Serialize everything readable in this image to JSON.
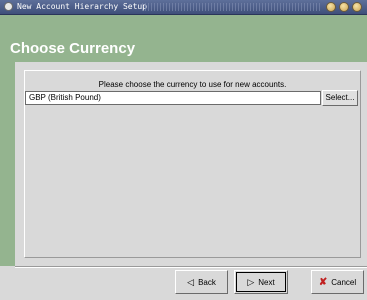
{
  "window": {
    "title": "New Account Hierarchy Setup",
    "controls": [
      "minimize",
      "maximize",
      "close"
    ]
  },
  "page": {
    "heading": "Choose Currency",
    "prompt": "Please choose the currency to use for new accounts.",
    "currency_value": "GBP (British Pound)",
    "select_label": "Select..."
  },
  "buttons": {
    "back": {
      "label": "Back",
      "icon": "arrow-left-icon"
    },
    "next": {
      "label": "Next",
      "icon": "arrow-right-icon"
    },
    "cancel": {
      "label": "Cancel",
      "icon": "cancel-x-icon"
    }
  },
  "colors": {
    "header_green": "#94b48f",
    "titlebar": "#4a5a85",
    "background": "#d9d9d9"
  }
}
